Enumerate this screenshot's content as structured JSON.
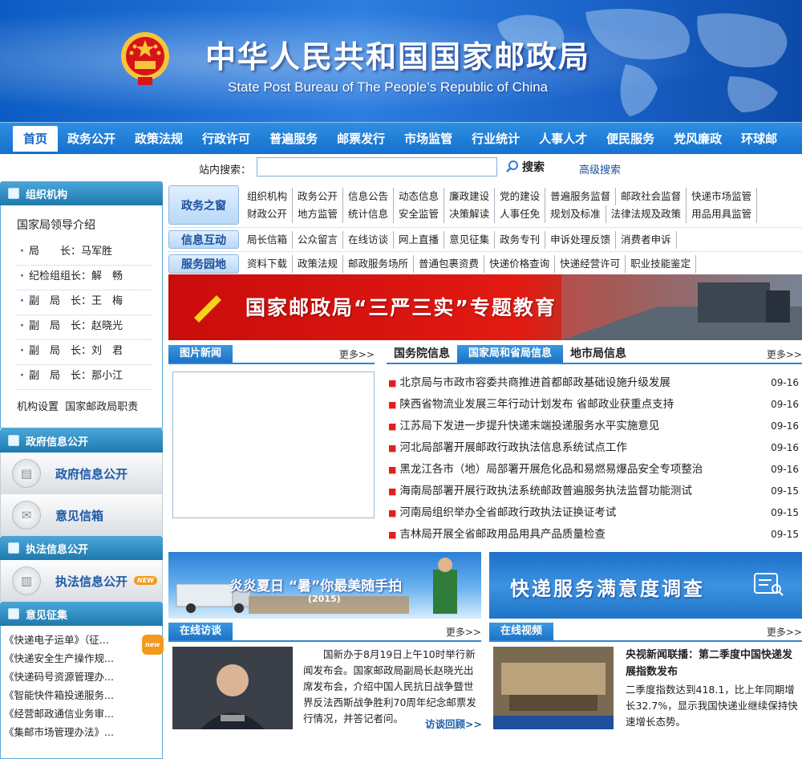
{
  "header": {
    "title_cn": "中华人民共和国国家邮政局",
    "title_en": "State Post Bureau of The People’s Republic of China"
  },
  "nav": [
    "首页",
    "政务公开",
    "政策法规",
    "行政许可",
    "普遍服务",
    "邮票发行",
    "市场监管",
    "行业统计",
    "人事人才",
    "便民服务",
    "党风廉政",
    "环球邮"
  ],
  "search": {
    "label": "站内搜索：",
    "button": "搜索",
    "advanced": "高级搜索",
    "value": ""
  },
  "left": {
    "org_title": "组织机构",
    "leaders_title": "国家局领导介绍",
    "leaders": [
      "局　　长：马军胜",
      "纪检组组长：解　畅",
      "副　局　长：王　梅",
      "副　局　长：赵晓光",
      "副　局　长：刘　君",
      "副　局　长：那小江"
    ],
    "org_links": [
      "机构设置",
      "国家邮政局职责"
    ],
    "gov_title": "政府信息公开",
    "gov_btn": "政府信息公开",
    "mail_btn": "意见信箱",
    "law_title": "执法信息公开",
    "law_btn": "执法信息公开",
    "new_tag": "NEW",
    "opinion_title": "意见征集",
    "opinions": [
      "《快递电子运单》（征...",
      "《快递安全生产操作规...",
      "《快递码号资源管理办...",
      "《智能快件箱投递服务...",
      "《经营邮政通信业务审...",
      "《集邮市场管理办法》..."
    ],
    "opinion_new_tag": "new"
  },
  "quick": [
    {
      "label": "政务之窗",
      "links": [
        "组织机构",
        "政务公开",
        "信息公告",
        "动态信息",
        "廉政建设",
        "党的建设",
        "普遍服务监督",
        "邮政社会监督",
        "快递市场监管",
        "财政公开",
        "地方监管",
        "统计信息",
        "安全监管",
        "决策解读",
        "人事任免",
        "规划及标准",
        "法律法规及政策",
        "用品用具监管"
      ]
    },
    {
      "label": "信息互动",
      "links": [
        "局长信箱",
        "公众留言",
        "在线访谈",
        "网上直播",
        "意见征集",
        "政务专刊",
        "申诉处理反馈",
        "消费者申诉"
      ]
    },
    {
      "label": "服务园地",
      "links": [
        "资料下载",
        "政策法规",
        "邮政服务场所",
        "普通包裹资费",
        "快递价格查询",
        "快递经营许可",
        "职业技能鉴定"
      ]
    }
  ],
  "banner": {
    "text": "国家邮政局“三严三实”专题教育"
  },
  "picnews": {
    "title": "图片新闻",
    "more": "更多>>"
  },
  "newstabs": {
    "tabs": [
      "国务院信息",
      "国家局和省局信息",
      "地市局信息"
    ],
    "more": "更多>>"
  },
  "news": [
    {
      "title": "北京局与市政市容委共商推进首都邮政基础设施升级发展",
      "date": "09-16"
    },
    {
      "title": "陕西省物流业发展三年行动计划发布 省邮政业获重点支持",
      "date": "09-16"
    },
    {
      "title": "江苏局下发进一步提升快递末端投递服务水平实施意见",
      "date": "09-16"
    },
    {
      "title": "河北局部署开展邮政行政执法信息系统试点工作",
      "date": "09-16"
    },
    {
      "title": "黑龙江各市（地）局部署开展危化品和易燃易爆品安全专项整治",
      "date": "09-16"
    },
    {
      "title": "海南局部署开展行政执法系统邮政普遍服务执法监督功能测试",
      "date": "09-15"
    },
    {
      "title": "河南局组织举办全省邮政行政执法证换证考试",
      "date": "09-15"
    },
    {
      "title": "吉林局开展全省邮政用品用具产品质量检查",
      "date": "09-15"
    }
  ],
  "banner1": {
    "text": "炎炎夏日 “暑”你最美随手拍",
    "year": "(2015)"
  },
  "banner2": {
    "text": "快递服务满意度调查"
  },
  "interview": {
    "title": "在线访谈",
    "more": "更多>>",
    "text": "国新办于8月19日上午10时举行新闻发布会。国家邮政局副局长赵晓光出席发布会，介绍中国人民抗日战争暨世界反法西斯战争胜利70周年纪念邮票发行情况，并答记者问。",
    "review": "访谈回顾>>"
  },
  "video": {
    "title": "在线视频",
    "more": "更多>>",
    "headline": "央视新闻联播：第二季度中国快递发展指数发布",
    "text": "二季度指数达到418.1，比上年同期增长32.7%，显示我国快递业继续保持快速增长态势。"
  },
  "colors": {
    "nav": "#1570cf",
    "header": "#2c7ee0",
    "accent_red": "#e21a12"
  }
}
